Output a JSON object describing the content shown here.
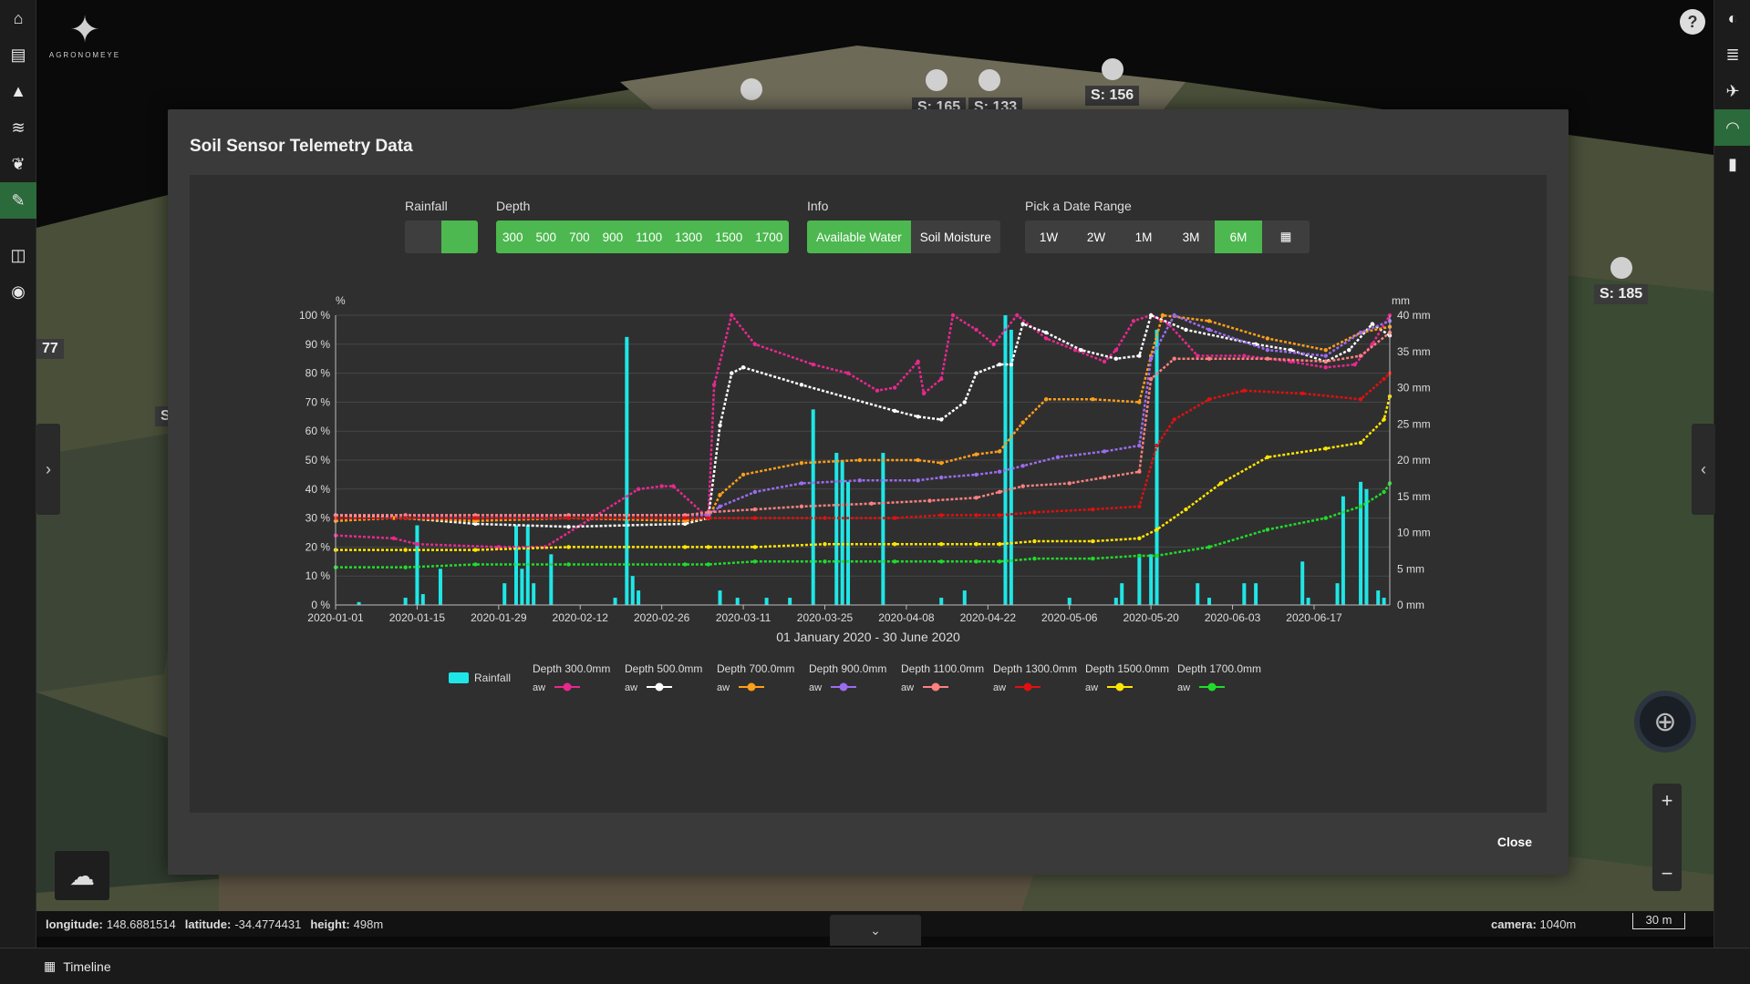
{
  "app": {
    "logo_text": "AGRONOMEYE",
    "help_label": "?"
  },
  "rail": {
    "items": [
      {
        "name": "home-icon",
        "glyph": "⌂"
      },
      {
        "name": "map-icon",
        "glyph": "▤"
      },
      {
        "name": "terrain-icon",
        "glyph": "▲"
      },
      {
        "name": "layers-icon",
        "glyph": "≋"
      },
      {
        "name": "plant-icon",
        "glyph": "❦"
      },
      {
        "name": "sensor-tools-icon",
        "glyph": "✎"
      },
      {
        "name": "compare-icon",
        "glyph": "◫"
      },
      {
        "name": "camera-icon",
        "glyph": "◉"
      }
    ]
  },
  "map": {
    "sensor_labels": [
      "S: 165",
      "S: 133",
      "S: 156",
      "S: 185",
      "77",
      "S"
    ]
  },
  "modal": {
    "title": "Soil Sensor Telemetry Data",
    "close_label": "Close",
    "rainfall": {
      "label": "Rainfall",
      "state": "on"
    },
    "depth": {
      "label": "Depth",
      "options": [
        "300",
        "500",
        "700",
        "900",
        "1100",
        "1300",
        "1500",
        "1700"
      ]
    },
    "info": {
      "label": "Info",
      "options": [
        "Available Water",
        "Soil Moisture"
      ],
      "selected": "Available Water"
    },
    "range": {
      "label": "Pick a Date Range",
      "options": [
        "1W",
        "2W",
        "1M",
        "3M",
        "6M"
      ],
      "selected": "6M"
    }
  },
  "chart_data": {
    "type": "line",
    "title": "",
    "xlabel": "01 January 2020 - 30 June 2020",
    "ylabel_left": "%",
    "ylabel_right": "mm",
    "x_ticks": [
      "2020-01-01",
      "2020-01-15",
      "2020-01-29",
      "2020-02-12",
      "2020-02-26",
      "2020-03-11",
      "2020-03-25",
      "2020-04-08",
      "2020-04-22",
      "2020-05-06",
      "2020-05-20",
      "2020-06-03",
      "2020-06-17"
    ],
    "y_left_ticks": [
      "0 %",
      "10 %",
      "20 %",
      "30 %",
      "40 %",
      "50 %",
      "60 %",
      "70 %",
      "80 %",
      "90 %",
      "100 %"
    ],
    "y_right_ticks": [
      "0 mm",
      "5 mm",
      "10 mm",
      "15 mm",
      "20 mm",
      "25 mm",
      "30 mm",
      "35 mm",
      "40 mm"
    ],
    "ylim_left": [
      0,
      100
    ],
    "ylim_right": [
      0,
      40
    ],
    "xlim_days": [
      0,
      181
    ],
    "legend_rainfall": "Rainfall",
    "legend_aw": "aw",
    "series": [
      {
        "name": "Depth 300.0mm",
        "color": "#e8288f",
        "points": [
          [
            0,
            24
          ],
          [
            10,
            23
          ],
          [
            14,
            21
          ],
          [
            28,
            20
          ],
          [
            36,
            20
          ],
          [
            44,
            30
          ],
          [
            52,
            40
          ],
          [
            56,
            41
          ],
          [
            58,
            41
          ],
          [
            64,
            30
          ],
          [
            65,
            76
          ],
          [
            68,
            100
          ],
          [
            72,
            90
          ],
          [
            82,
            83
          ],
          [
            88,
            80
          ],
          [
            93,
            74
          ],
          [
            96,
            75
          ],
          [
            100,
            84
          ],
          [
            101,
            73
          ],
          [
            104,
            78
          ],
          [
            106,
            100
          ],
          [
            110,
            95
          ],
          [
            113,
            90
          ],
          [
            117,
            100
          ],
          [
            122,
            92
          ],
          [
            127,
            88
          ],
          [
            132,
            84
          ],
          [
            134,
            88
          ],
          [
            137,
            98
          ],
          [
            140,
            100
          ],
          [
            143,
            97
          ],
          [
            148,
            86
          ],
          [
            156,
            86
          ],
          [
            164,
            84
          ],
          [
            170,
            82
          ],
          [
            175,
            83
          ],
          [
            178,
            90
          ],
          [
            181,
            100
          ]
        ]
      },
      {
        "name": "Depth 500.0mm",
        "color": "#ffffff",
        "points": [
          [
            0,
            31
          ],
          [
            12,
            30
          ],
          [
            24,
            28
          ],
          [
            40,
            27
          ],
          [
            60,
            28
          ],
          [
            64,
            30
          ],
          [
            66,
            62
          ],
          [
            68,
            80
          ],
          [
            70,
            82
          ],
          [
            80,
            76
          ],
          [
            96,
            67
          ],
          [
            100,
            65
          ],
          [
            104,
            64
          ],
          [
            108,
            70
          ],
          [
            110,
            80
          ],
          [
            114,
            83
          ],
          [
            116,
            83
          ],
          [
            118,
            97
          ],
          [
            122,
            94
          ],
          [
            128,
            88
          ],
          [
            134,
            85
          ],
          [
            138,
            86
          ],
          [
            140,
            100
          ],
          [
            146,
            95
          ],
          [
            158,
            90
          ],
          [
            164,
            88
          ],
          [
            170,
            84
          ],
          [
            174,
            88
          ],
          [
            178,
            97
          ],
          [
            181,
            93
          ]
        ]
      },
      {
        "name": "Depth 700.0mm",
        "color": "#ff9f1a",
        "points": [
          [
            0,
            29
          ],
          [
            10,
            30
          ],
          [
            24,
            29
          ],
          [
            40,
            30
          ],
          [
            60,
            29
          ],
          [
            64,
            30
          ],
          [
            66,
            38
          ],
          [
            70,
            45
          ],
          [
            80,
            49
          ],
          [
            90,
            50
          ],
          [
            100,
            50
          ],
          [
            104,
            49
          ],
          [
            110,
            52
          ],
          [
            114,
            53
          ],
          [
            118,
            63
          ],
          [
            122,
            71
          ],
          [
            130,
            71
          ],
          [
            138,
            70
          ],
          [
            140,
            86
          ],
          [
            142,
            100
          ],
          [
            150,
            98
          ],
          [
            160,
            92
          ],
          [
            170,
            88
          ],
          [
            176,
            94
          ],
          [
            181,
            96
          ]
        ]
      },
      {
        "name": "Depth 900.0mm",
        "color": "#9b6cf0",
        "points": [
          [
            0,
            31
          ],
          [
            12,
            31
          ],
          [
            24,
            30
          ],
          [
            40,
            31
          ],
          [
            60,
            31
          ],
          [
            64,
            31
          ],
          [
            66,
            34
          ],
          [
            72,
            39
          ],
          [
            80,
            42
          ],
          [
            90,
            43
          ],
          [
            100,
            43
          ],
          [
            104,
            44
          ],
          [
            110,
            45
          ],
          [
            114,
            46
          ],
          [
            118,
            48
          ],
          [
            124,
            51
          ],
          [
            132,
            53
          ],
          [
            138,
            55
          ],
          [
            140,
            85
          ],
          [
            144,
            100
          ],
          [
            150,
            95
          ],
          [
            160,
            88
          ],
          [
            170,
            86
          ],
          [
            176,
            94
          ],
          [
            181,
            98
          ]
        ]
      },
      {
        "name": "Depth 1100.0mm",
        "color": "#ff8080",
        "points": [
          [
            0,
            31
          ],
          [
            12,
            31
          ],
          [
            24,
            31
          ],
          [
            40,
            31
          ],
          [
            60,
            31
          ],
          [
            64,
            32
          ],
          [
            72,
            33
          ],
          [
            80,
            34
          ],
          [
            92,
            35
          ],
          [
            102,
            36
          ],
          [
            110,
            37
          ],
          [
            114,
            39
          ],
          [
            118,
            41
          ],
          [
            126,
            42
          ],
          [
            132,
            44
          ],
          [
            138,
            46
          ],
          [
            140,
            78
          ],
          [
            144,
            85
          ],
          [
            150,
            85
          ],
          [
            160,
            85
          ],
          [
            170,
            84
          ],
          [
            176,
            86
          ],
          [
            181,
            94
          ]
        ]
      },
      {
        "name": "Depth 1300.0mm",
        "color": "#e01010",
        "points": [
          [
            0,
            30
          ],
          [
            12,
            30
          ],
          [
            24,
            30
          ],
          [
            40,
            30
          ],
          [
            60,
            30
          ],
          [
            64,
            30
          ],
          [
            72,
            30
          ],
          [
            84,
            30
          ],
          [
            96,
            30
          ],
          [
            104,
            31
          ],
          [
            110,
            31
          ],
          [
            114,
            31
          ],
          [
            120,
            32
          ],
          [
            130,
            33
          ],
          [
            138,
            34
          ],
          [
            141,
            55
          ],
          [
            144,
            64
          ],
          [
            150,
            71
          ],
          [
            156,
            74
          ],
          [
            166,
            73
          ],
          [
            176,
            71
          ],
          [
            180,
            78
          ],
          [
            181,
            80
          ]
        ]
      },
      {
        "name": "Depth 1500.0mm",
        "color": "#ffe600",
        "points": [
          [
            0,
            19
          ],
          [
            12,
            19
          ],
          [
            24,
            19
          ],
          [
            40,
            20
          ],
          [
            60,
            20
          ],
          [
            64,
            20
          ],
          [
            72,
            20
          ],
          [
            84,
            21
          ],
          [
            96,
            21
          ],
          [
            104,
            21
          ],
          [
            110,
            21
          ],
          [
            114,
            21
          ],
          [
            120,
            22
          ],
          [
            130,
            22
          ],
          [
            138,
            23
          ],
          [
            141,
            26
          ],
          [
            146,
            33
          ],
          [
            152,
            42
          ],
          [
            160,
            51
          ],
          [
            170,
            54
          ],
          [
            176,
            56
          ],
          [
            180,
            64
          ],
          [
            181,
            72
          ]
        ]
      },
      {
        "name": "Depth 1700.0mm",
        "color": "#1fdc2a",
        "points": [
          [
            0,
            13
          ],
          [
            12,
            13
          ],
          [
            24,
            14
          ],
          [
            40,
            14
          ],
          [
            60,
            14
          ],
          [
            64,
            14
          ],
          [
            72,
            15
          ],
          [
            84,
            15
          ],
          [
            96,
            15
          ],
          [
            104,
            15
          ],
          [
            110,
            15
          ],
          [
            114,
            15
          ],
          [
            120,
            16
          ],
          [
            130,
            16
          ],
          [
            138,
            17
          ],
          [
            141,
            17
          ],
          [
            150,
            20
          ],
          [
            160,
            26
          ],
          [
            170,
            30
          ],
          [
            176,
            34
          ],
          [
            180,
            39
          ],
          [
            181,
            42
          ]
        ]
      }
    ],
    "rainfall": {
      "color": "#1fe6e6",
      "bars_mm": [
        [
          4,
          0.4
        ],
        [
          12,
          1
        ],
        [
          14,
          11
        ],
        [
          15,
          1.5
        ],
        [
          18,
          5
        ],
        [
          29,
          3
        ],
        [
          31,
          11
        ],
        [
          32,
          5
        ],
        [
          33,
          11
        ],
        [
          34,
          3
        ],
        [
          37,
          7
        ],
        [
          48,
          1
        ],
        [
          50,
          37
        ],
        [
          51,
          4
        ],
        [
          52,
          2
        ],
        [
          66,
          2
        ],
        [
          69,
          1
        ],
        [
          74,
          1
        ],
        [
          78,
          1
        ],
        [
          82,
          27
        ],
        [
          86,
          21
        ],
        [
          87,
          20
        ],
        [
          88,
          17
        ],
        [
          94,
          21
        ],
        [
          104,
          1
        ],
        [
          108,
          2
        ],
        [
          115,
          40
        ],
        [
          116,
          38
        ],
        [
          126,
          1
        ],
        [
          134,
          1
        ],
        [
          135,
          3
        ],
        [
          138,
          7
        ],
        [
          140,
          7
        ],
        [
          141,
          38
        ],
        [
          148,
          3
        ],
        [
          150,
          1
        ],
        [
          156,
          3
        ],
        [
          158,
          3
        ],
        [
          166,
          6
        ],
        [
          167,
          1
        ],
        [
          172,
          3
        ],
        [
          173,
          15
        ],
        [
          176,
          17
        ],
        [
          177,
          16
        ],
        [
          179,
          2
        ],
        [
          180,
          1
        ]
      ]
    }
  },
  "status": {
    "longitude_label": "longitude:",
    "longitude": "148.6881514",
    "latitude_label": "latitude:",
    "latitude": "-34.4774431",
    "height_label": "height:",
    "height": "498m",
    "camera_label": "camera:",
    "camera": "1040m",
    "scale": "30 m"
  },
  "timeline": {
    "label": "Timeline"
  }
}
